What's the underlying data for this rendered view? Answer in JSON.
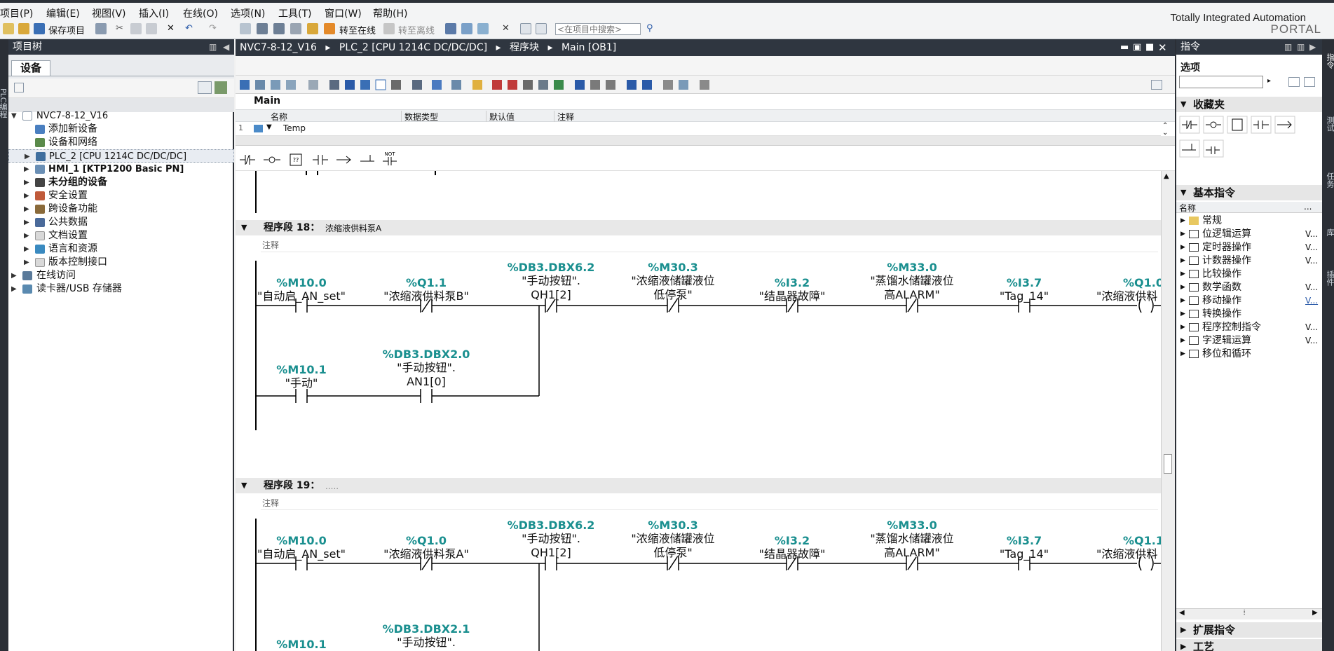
{
  "menu": [
    "项目(P)",
    "编辑(E)",
    "视图(V)",
    "插入(I)",
    "在线(O)",
    "选项(N)",
    "工具(T)",
    "窗口(W)",
    "帮助(H)"
  ],
  "toolbar": {
    "save_project": "保存项目",
    "go_online": "转至在线",
    "go_offline": "转至离线",
    "search_placeholder": "<在项目中搜索>"
  },
  "branding": {
    "line1": "Totally Integrated Automation",
    "line2": "PORTAL"
  },
  "project_tree": {
    "title": "项目树",
    "tab": "设备",
    "items": [
      {
        "label": "NVC7-8-12_V16",
        "level": 0,
        "expanded": true
      },
      {
        "label": "添加新设备",
        "level": 1
      },
      {
        "label": "设备和网络",
        "level": 1
      },
      {
        "label": "PLC_2 [CPU 1214C DC/DC/DC]",
        "level": 1,
        "selected": true
      },
      {
        "label": "HMI_1 [KTP1200 Basic PN]",
        "level": 1
      },
      {
        "label": "未分组的设备",
        "level": 1
      },
      {
        "label": "安全设置",
        "level": 1
      },
      {
        "label": "跨设备功能",
        "level": 1
      },
      {
        "label": "公共数据",
        "level": 1
      },
      {
        "label": "文档设置",
        "level": 1
      },
      {
        "label": "语言和资源",
        "level": 1
      },
      {
        "label": "版本控制接口",
        "level": 1
      },
      {
        "label": "在线访问",
        "level": 0
      },
      {
        "label": "读卡器/USB 存储器",
        "level": 0
      }
    ]
  },
  "breadcrumb": [
    "NVC7-8-12_V16",
    "PLC_2 [CPU 1214C DC/DC/DC]",
    "程序块",
    "Main [OB1]"
  ],
  "interface": {
    "block_name": "Main",
    "columns": [
      "名称",
      "数据类型",
      "默认值",
      "注释"
    ],
    "rows": [
      {
        "num": "1",
        "name": "Temp"
      }
    ]
  },
  "palette_labels": {
    "not": "NOT",
    "box": "??"
  },
  "segments": [
    {
      "title": "程序段 18：",
      "subtitle": "浓缩液供料泵A",
      "comment": "注释",
      "row1": [
        {
          "addr": "%M10.0",
          "name1": "\"自动启_AN_set\"",
          "name2": ""
        },
        {
          "addr": "%Q1.1",
          "name1": "\"浓缩液供料泵B\"",
          "name2": ""
        },
        {
          "addr": "%DB3.DBX6.2",
          "name1": "\"手动按钮\".",
          "name2": "QH1[2]"
        },
        {
          "addr": "%M30.3",
          "name1": "\"浓缩液储罐液位",
          "name2": "低停泵\""
        },
        {
          "addr": "%I3.2",
          "name1": "\"结晶器故障\"",
          "name2": ""
        },
        {
          "addr": "%M33.0",
          "name1": "\"蒸馏水储罐液位",
          "name2": "高ALARM\""
        },
        {
          "addr": "%I3.7",
          "name1": "\"Tag_14\"",
          "name2": ""
        },
        {
          "addr": "%Q1.0",
          "name1": "\"浓缩液供料",
          "name2": ""
        }
      ],
      "row2": [
        {
          "addr": "%M10.1",
          "name1": "\"手动\"",
          "name2": ""
        },
        {
          "addr": "%DB3.DBX2.0",
          "name1": "\"手动按钮\".",
          "name2": "AN1[0]"
        }
      ]
    },
    {
      "title": "程序段 19：",
      "subtitle": ".....",
      "comment": "注释",
      "row1": [
        {
          "addr": "%M10.0",
          "name1": "\"自动启_AN_set\"",
          "name2": ""
        },
        {
          "addr": "%Q1.0",
          "name1": "\"浓缩液供料泵A\"",
          "name2": ""
        },
        {
          "addr": "%DB3.DBX6.2",
          "name1": "\"手动按钮\".",
          "name2": "QH1[2]"
        },
        {
          "addr": "%M30.3",
          "name1": "\"浓缩液储罐液位",
          "name2": "低停泵\""
        },
        {
          "addr": "%I3.2",
          "name1": "\"结晶器故障\"",
          "name2": ""
        },
        {
          "addr": "%M33.0",
          "name1": "\"蒸馏水储罐液位",
          "name2": "高ALARM\""
        },
        {
          "addr": "%I3.7",
          "name1": "\"Tag_14\"",
          "name2": ""
        },
        {
          "addr": "%Q1.1",
          "name1": "\"浓缩液供料",
          "name2": ""
        }
      ],
      "row2": [
        {
          "addr": "%M10.1",
          "name1": "",
          "name2": ""
        },
        {
          "addr": "%DB3.DBX2.1",
          "name1": "\"手动按钮\".",
          "name2": ""
        }
      ]
    }
  ],
  "instructions": {
    "title": "指令",
    "options": "选项",
    "favorites": "收藏夹",
    "basic": "基本指令",
    "name_col": "名称",
    "name_col_more": "...",
    "items": [
      {
        "label": "常规",
        "ver": ""
      },
      {
        "label": "位逻辑运算",
        "ver": "V..."
      },
      {
        "label": "定时器操作",
        "ver": "V..."
      },
      {
        "label": "计数器操作",
        "ver": "V..."
      },
      {
        "label": "比较操作",
        "ver": ""
      },
      {
        "label": "数学函数",
        "ver": "V..."
      },
      {
        "label": "移动操作",
        "ver": "V..."
      },
      {
        "label": "转换操作",
        "ver": ""
      },
      {
        "label": "程序控制指令",
        "ver": "V..."
      },
      {
        "label": "字逻辑运算",
        "ver": "V..."
      },
      {
        "label": "移位和循环",
        "ver": ""
      }
    ],
    "extended": "扩展指令",
    "tech": "工艺"
  },
  "side_tabs": {
    "left": "PLC编程",
    "right": [
      "指令",
      "测试",
      "任务",
      "库",
      "插件"
    ]
  }
}
